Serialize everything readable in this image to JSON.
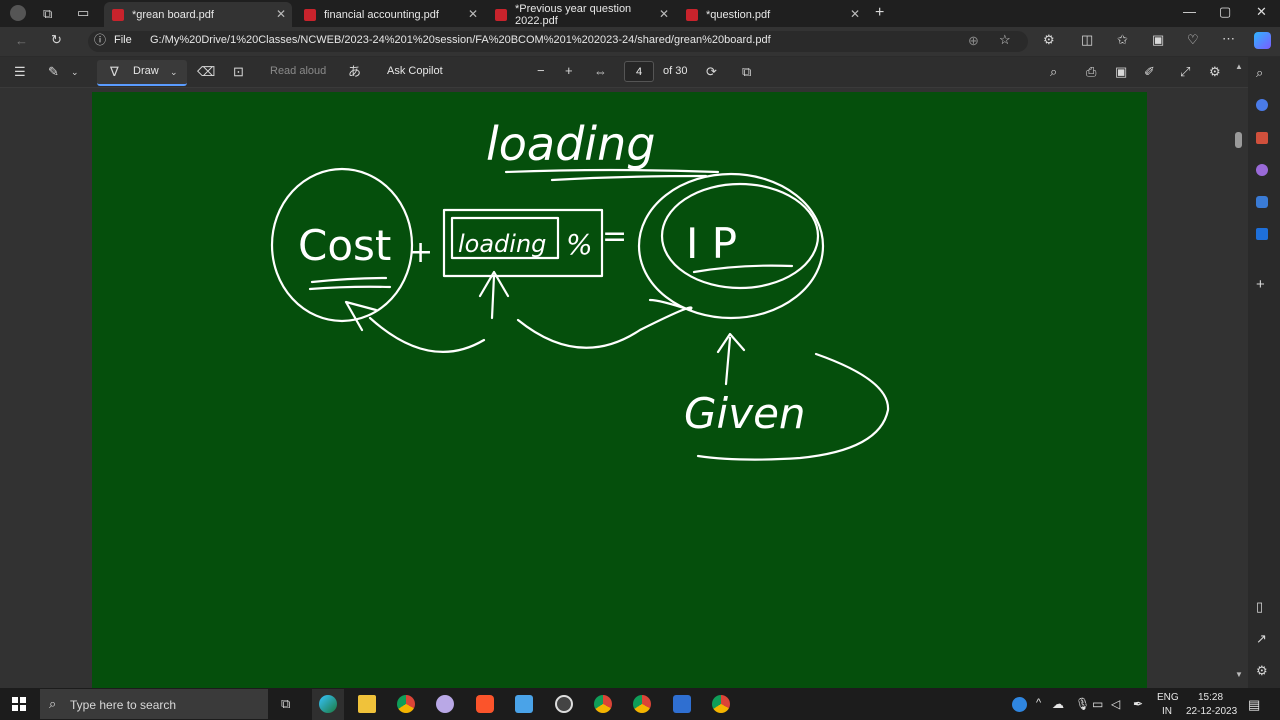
{
  "tabs": [
    {
      "title": "*grean board.pdf",
      "active": true
    },
    {
      "title": "financial accounting.pdf",
      "active": false
    },
    {
      "title": "*Previous year question 2022.pdf",
      "active": false
    },
    {
      "title": "*question.pdf",
      "active": false
    }
  ],
  "address": {
    "file_label": "File",
    "url": "G:/My%20Drive/1%20Classes/NCWEB/2023-24%201%20session/FA%20BCOM%201%202023-24/shared/grean%20board.pdf"
  },
  "pdf_toolbar": {
    "draw_label": "Draw",
    "read_aloud_label": "Read aloud",
    "ask_copilot_label": "Ask Copilot",
    "page_current": "4",
    "page_total": "of 30"
  },
  "board": {
    "background": "#054f0c",
    "handwriting": [
      "loading",
      "Cost",
      "+",
      "loading",
      "%",
      "=",
      "I P",
      "Given"
    ]
  },
  "taskbar": {
    "search_placeholder": "Type here to search",
    "lang_top": "ENG",
    "lang_bottom": "IN",
    "time": "15:28",
    "date": "22-12-2023"
  }
}
